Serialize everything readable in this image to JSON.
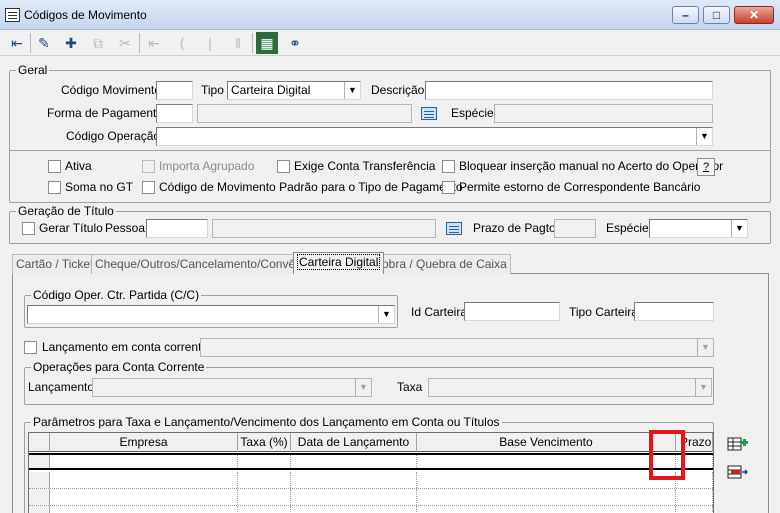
{
  "window": {
    "title": "Códigos de Movimento",
    "min_glyph": "–",
    "max_glyph": "□",
    "close_glyph": "✕"
  },
  "toolbar": {
    "buttons": [
      {
        "icon": "exit-icon",
        "glyph": "⇤",
        "enabled": true
      },
      {
        "icon": "eraser-icon",
        "glyph": "✎",
        "enabled": true
      },
      {
        "icon": "new-record-icon",
        "glyph": "✚",
        "enabled": true
      },
      {
        "icon": "copy-disabled-icon",
        "glyph": "⧉",
        "enabled": false
      },
      {
        "icon": "cut-disabled-icon",
        "glyph": "✂",
        "enabled": false
      },
      {
        "icon": "first-disabled-icon",
        "glyph": "⇤",
        "enabled": false
      },
      {
        "icon": "prev-disabled-icon",
        "glyph": "⟨",
        "enabled": false
      },
      {
        "icon": "pipe-disabled-icon",
        "glyph": "|",
        "enabled": false
      },
      {
        "icon": "pause-disabled-icon",
        "glyph": "‖",
        "enabled": false
      },
      {
        "icon": "grid-icon",
        "glyph": "▦",
        "enabled": true
      },
      {
        "icon": "binoculars-icon",
        "glyph": "⚭",
        "enabled": true
      }
    ]
  },
  "geral": {
    "title": "Geral",
    "codigo_movimento_label": "Código Movimento",
    "codigo_movimento_value": "",
    "tipo_label": "Tipo",
    "tipo_value": "Carteira Digital",
    "descricao_label": "Descrição",
    "descricao_value": "",
    "forma_pagamento_label": "Forma de Pagamento",
    "especie_label": "Espécie",
    "codigo_operacao_label": "Código Operação",
    "codigo_operacao_value": "",
    "checkboxes": {
      "ativa": "Ativa",
      "importa_agrupado": "Importa Agrupado",
      "exige_conta": "Exige Conta Transferência",
      "bloquear": "Bloquear inserção manual no Acerto do Operador",
      "soma_gt": "Soma no GT",
      "codigo_padrao": "Código de Movimento Padrão para o Tipo de Pagamento",
      "permite_estorno": "Permite estorno de Correspondente Bancário"
    },
    "help_button": "?"
  },
  "geracao": {
    "title": "Geração de Título",
    "gerar_titulo": "Gerar Título",
    "pessoa_label": "Pessoa",
    "prazo_label": "Prazo de Pagto",
    "especie_label": "Espécie"
  },
  "tabs": [
    {
      "label": "Cartão / Ticket",
      "active": false
    },
    {
      "label": "Cheque/Outros/Cancelamento/Convênio",
      "active": false
    },
    {
      "label": "Carteira Digital",
      "active": true
    },
    {
      "label": "Sobra / Quebra de Caixa",
      "active": false
    }
  ],
  "carteira": {
    "codigo_oper_title": "Código Oper. Ctr. Partida (C/C)",
    "id_carteira_label": "Id Carteira",
    "tipo_carteira_label": "Tipo Carteira",
    "lancamento_cc_label": "Lançamento em conta corrente",
    "operacoes_title": "Operações para Conta Corrente",
    "lancamento_label": "Lançamento",
    "taxa_label": "Taxa",
    "parametros_title": "Parâmetros para Taxa e Lançamento/Vencimento dos Lançamento em Conta ou Títulos",
    "grid_columns": [
      "Empresa",
      "Taxa (%)",
      "Data de Lançamento",
      "Base Vencimento",
      "Prazo"
    ]
  }
}
